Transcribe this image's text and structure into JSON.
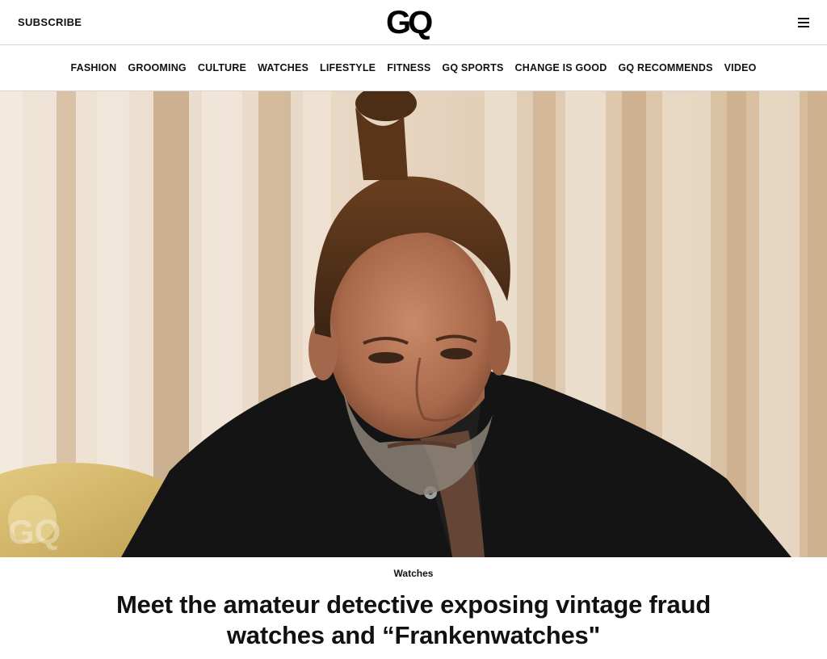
{
  "header": {
    "subscribe_label": "SUBSCRIBE",
    "logo_text": "GQ",
    "menu_icon": "hamburger-menu-icon"
  },
  "nav": {
    "items": [
      {
        "label": "FASHION"
      },
      {
        "label": "GROOMING"
      },
      {
        "label": "CULTURE"
      },
      {
        "label": "WATCHES"
      },
      {
        "label": "LIFESTYLE"
      },
      {
        "label": "FITNESS"
      },
      {
        "label": "GQ SPORTS"
      },
      {
        "label": "CHANGE IS GOOD"
      },
      {
        "label": "GQ RECOMMENDS"
      },
      {
        "label": "VIDEO"
      }
    ]
  },
  "article": {
    "category": "Watches",
    "headline": "Meet the amateur detective exposing vintage fraud watches and “Frankenwatches\""
  },
  "colors": {
    "text": "#111111",
    "divider": "#d6d6d6",
    "curtain_light": "#efe6da",
    "curtain_dark": "#c9ad8c",
    "shirt": "#141414"
  }
}
